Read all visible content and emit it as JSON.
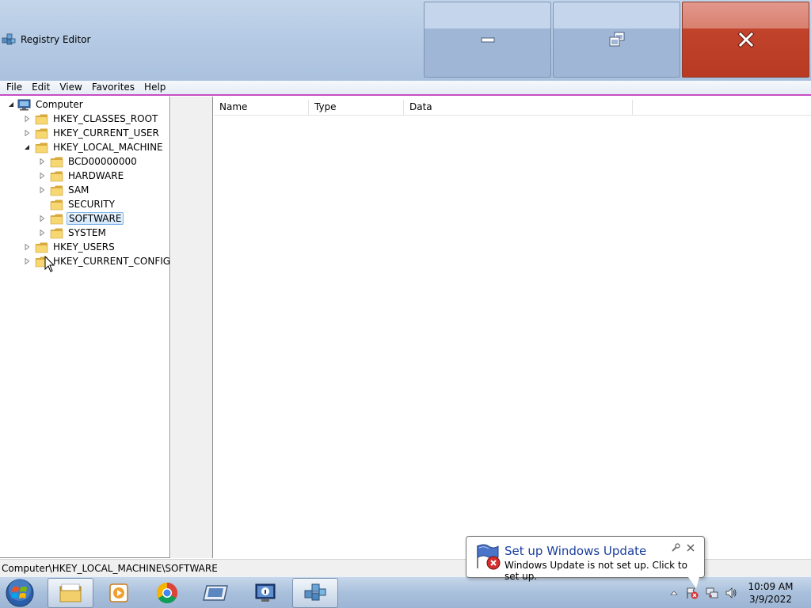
{
  "window": {
    "title": "Registry Editor"
  },
  "menu": [
    "File",
    "Edit",
    "View",
    "Favorites",
    "Help"
  ],
  "tree": [
    {
      "label": "Computer",
      "icon": "computer-icon",
      "state": "expanded",
      "level": 0
    },
    {
      "label": "HKEY_CLASSES_ROOT",
      "icon": "folder-icon",
      "state": "collapsed",
      "level": 1
    },
    {
      "label": "HKEY_CURRENT_USER",
      "icon": "folder-icon",
      "state": "collapsed",
      "level": 1
    },
    {
      "label": "HKEY_LOCAL_MACHINE",
      "icon": "folder-icon",
      "state": "expanded",
      "level": 1
    },
    {
      "label": "BCD00000000",
      "icon": "folder-icon",
      "state": "collapsed",
      "level": 2
    },
    {
      "label": "HARDWARE",
      "icon": "folder-icon",
      "state": "collapsed",
      "level": 2
    },
    {
      "label": "SAM",
      "icon": "folder-icon",
      "state": "collapsed",
      "level": 2
    },
    {
      "label": "SECURITY",
      "icon": "folder-icon",
      "state": "leaf",
      "level": 2
    },
    {
      "label": "SOFTWARE",
      "icon": "folder-icon",
      "state": "collapsed",
      "level": 2,
      "selected": true
    },
    {
      "label": "SYSTEM",
      "icon": "folder-icon",
      "state": "collapsed",
      "level": 2
    },
    {
      "label": "HKEY_USERS",
      "icon": "folder-icon",
      "state": "collapsed",
      "level": 1
    },
    {
      "label": "HKEY_CURRENT_CONFIG",
      "icon": "folder-icon",
      "state": "collapsed",
      "level": 1
    }
  ],
  "values": {
    "columns": [
      "Name",
      "Type",
      "Data"
    ],
    "rows": []
  },
  "statusbar": {
    "path": "Computer\\HKEY_LOCAL_MACHINE\\SOFTWARE"
  },
  "taskbar": {
    "start": "windows-start-orb",
    "pinned": [
      "file-explorer-icon",
      "media-player-icon",
      "chrome-icon",
      "remote-desktop-icon",
      "system-info-icon",
      "registry-editor-icon"
    ],
    "active": "registry-editor-icon",
    "tray": [
      "show-hidden-icons",
      "action-center-alert-icon",
      "network-icon",
      "volume-icon"
    ],
    "clock": {
      "time": "10:09 AM",
      "date": "3/9/2022"
    }
  },
  "notification": {
    "title": "Set up Windows Update",
    "text": "Windows Update is not set up. Click to set up."
  },
  "colors": {
    "title_bar": "#b6cbe4",
    "close_button": "#c2432c",
    "selection_border": "#7db2e8",
    "balloon_title": "#1a3e9e"
  }
}
